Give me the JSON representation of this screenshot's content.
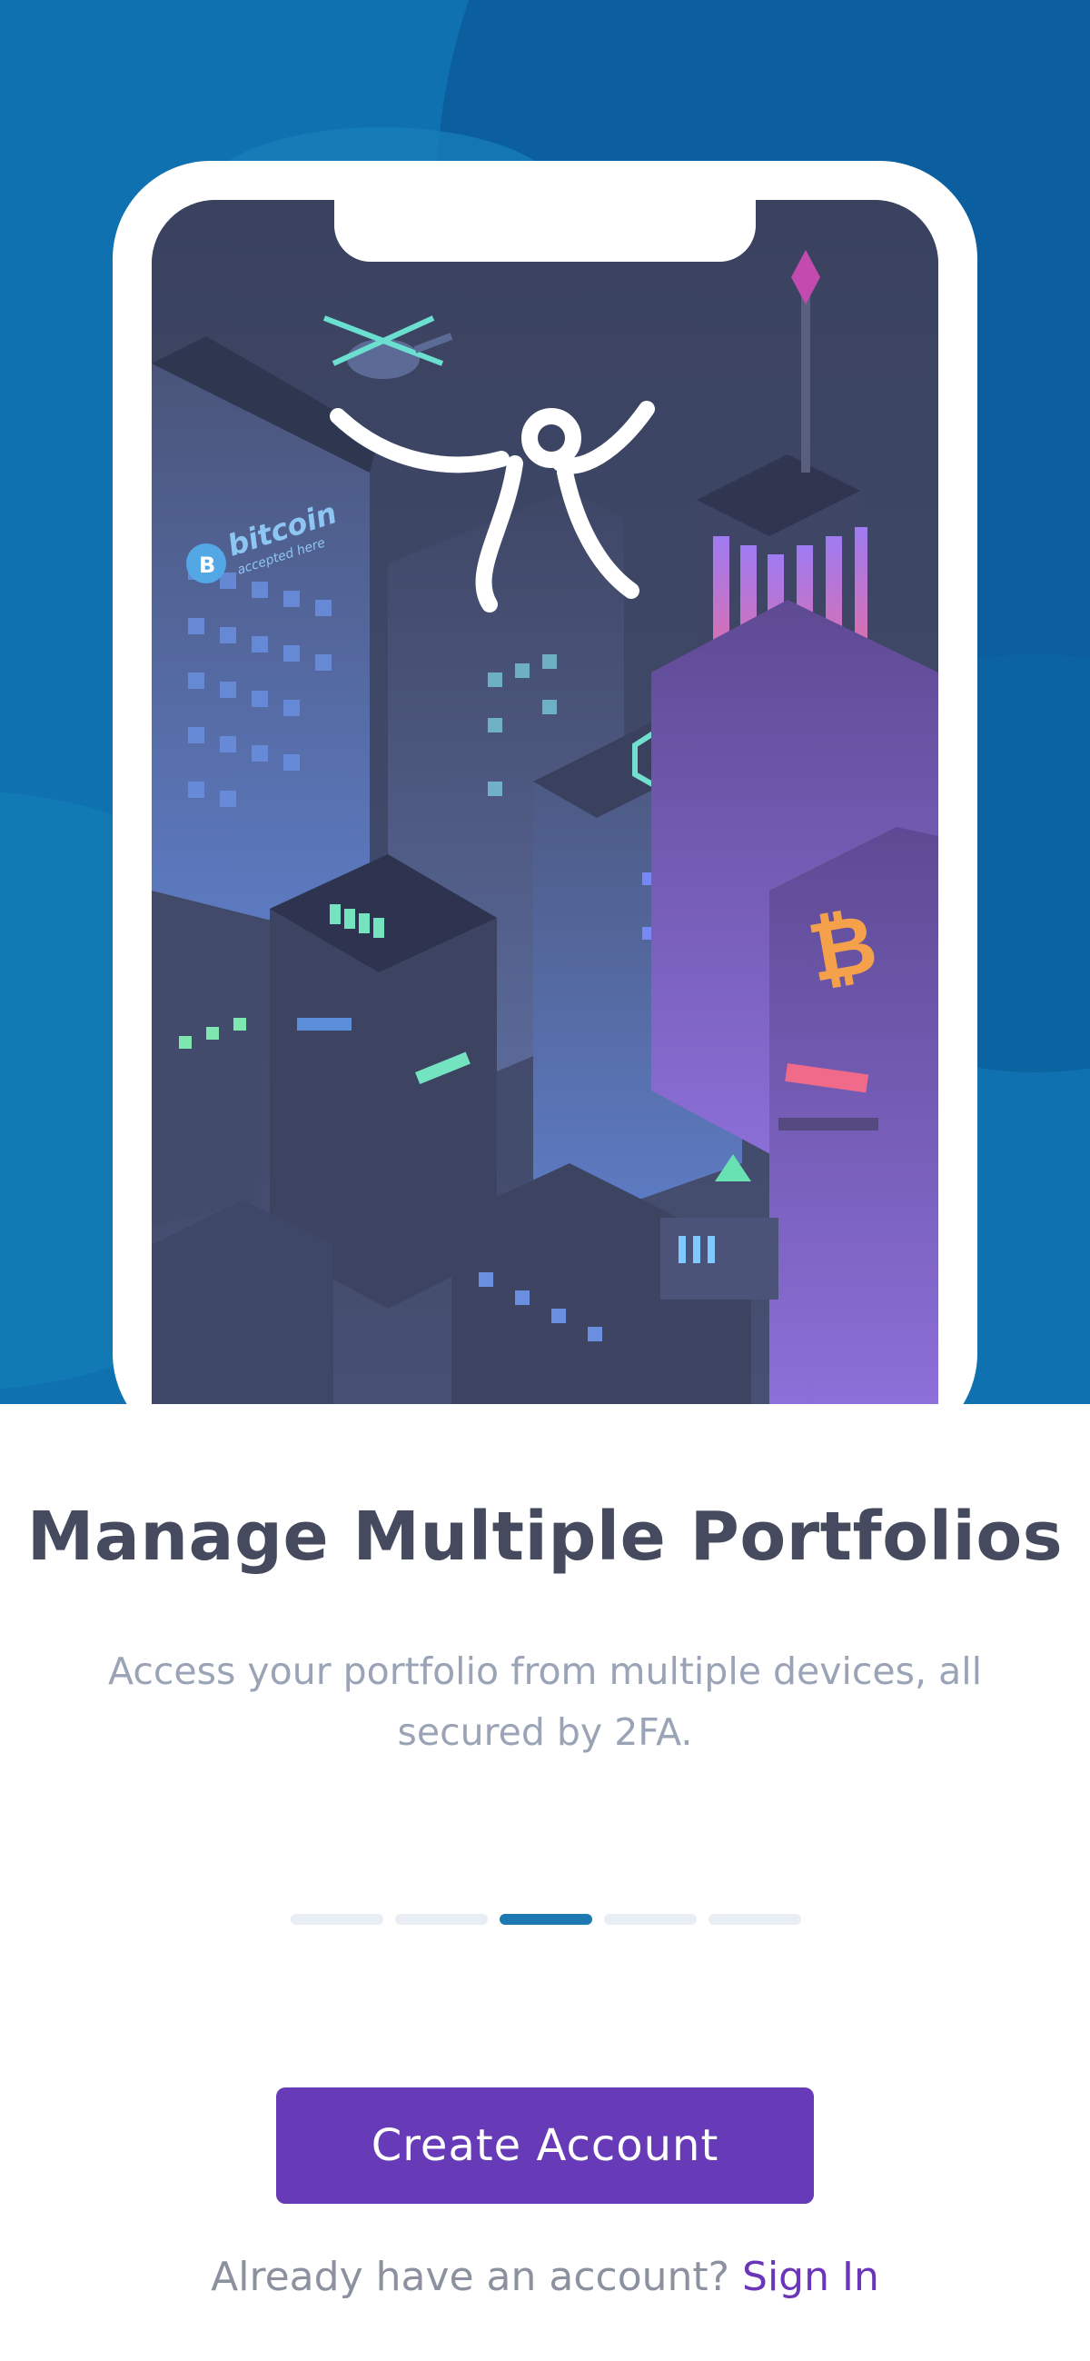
{
  "onboarding": {
    "title": "Manage Multiple Portfolios",
    "subtitle": "Access your portfolio from multiple devices, all secured by 2FA.",
    "page_indicator": {
      "total": 5,
      "active_index": 2
    },
    "cta_label": "Create Account",
    "signin_prompt": "Already have an account?",
    "signin_link": "Sign In"
  },
  "illustration": {
    "billboard_text": "bitcoin",
    "billboard_subtext": "accepted here",
    "logo_icon": "jumping-figure-icon",
    "coin_icons": [
      "bitcoin-icon",
      "ethereum-icon"
    ]
  },
  "colors": {
    "hero_bg": "#0f6fae",
    "accent_button": "#673ab7",
    "link": "#6a35b8",
    "indicator_active": "#1c79b2",
    "indicator_inactive": "#e9eef4"
  }
}
